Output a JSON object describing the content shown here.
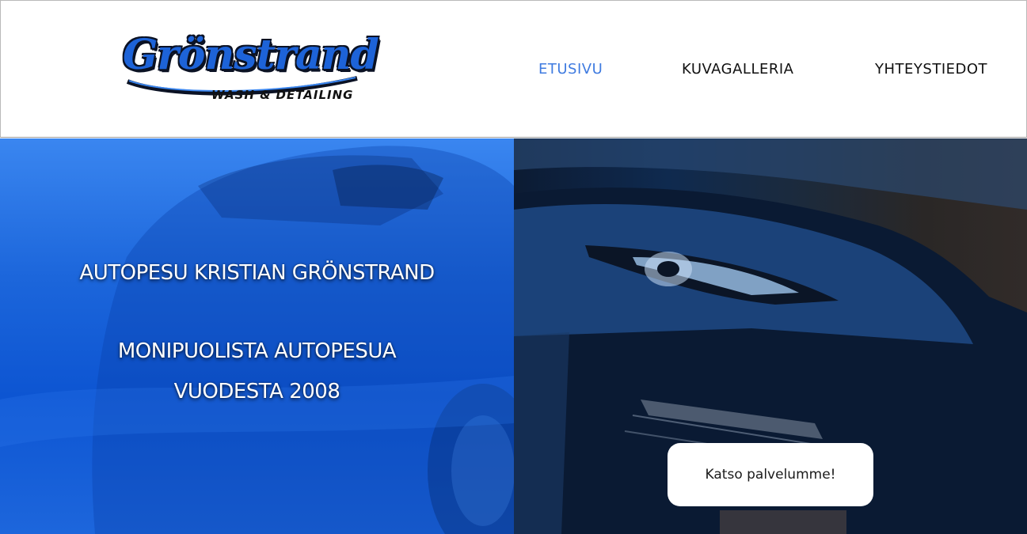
{
  "brand": {
    "logo_text": "Grönstrand",
    "logo_subtext": "WASH & DETAILING"
  },
  "nav": {
    "items": [
      {
        "label": "ETUSIVU",
        "active": true
      },
      {
        "label": "KUVAGALLERIA",
        "active": false
      },
      {
        "label": "YHTEYSTIEDOT",
        "active": false
      }
    ]
  },
  "hero": {
    "title": "AUTOPESU KRISTIAN GRÖNSTRAND",
    "subtitle_line1": "MONIPUOLISTA AUTOPESUA",
    "subtitle_line2": "VUODESTA 2008",
    "cta_label": "Katso palvelumme!"
  },
  "colors": {
    "accent": "#3f7be0",
    "hero_blue": "#1663e0",
    "header_bg": "#ffffff",
    "nav_text": "#111111"
  }
}
